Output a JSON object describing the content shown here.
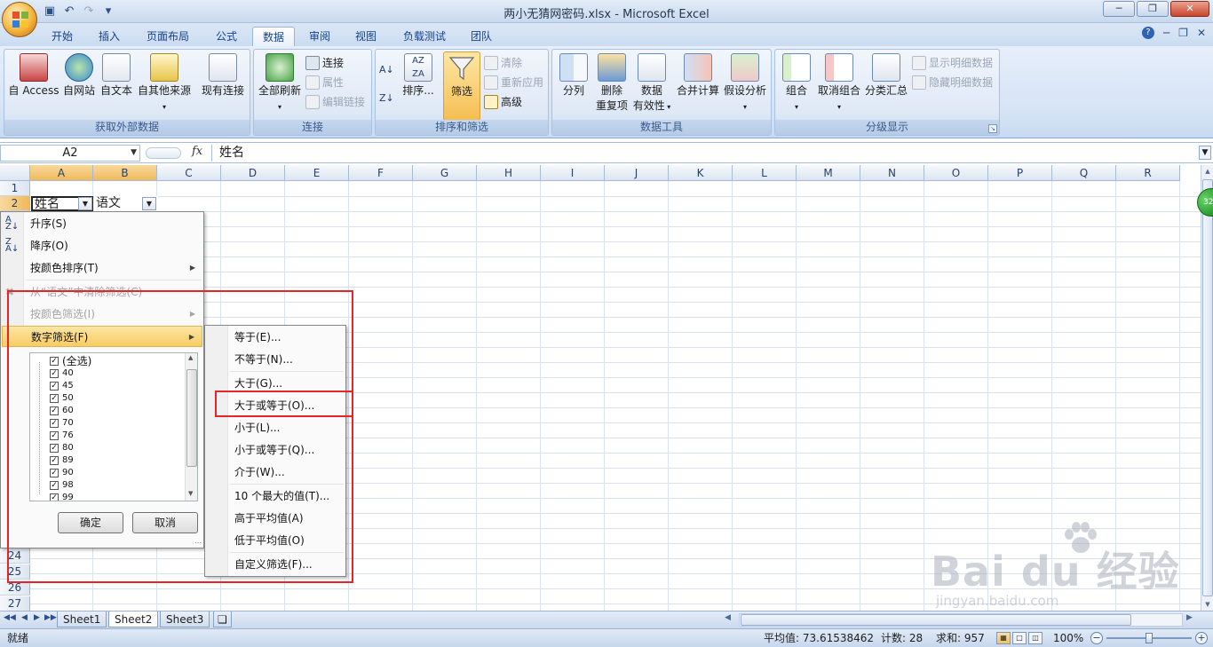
{
  "window": {
    "title": "两小无猜网密码.xlsx - Microsoft Excel"
  },
  "ribbon_tabs": [
    "开始",
    "插入",
    "页面布局",
    "公式",
    "数据",
    "审阅",
    "视图",
    "负载测试",
    "团队"
  ],
  "ribbon": {
    "external": {
      "label": "获取外部数据",
      "access": "自 Access",
      "web": "自网站",
      "text": "自文本",
      "other": "自其他来源",
      "existing": "现有连接"
    },
    "connections": {
      "label": "连接",
      "refresh_all": "全部刷新",
      "connections": "连接",
      "properties": "属性",
      "edit_links": "编辑链接"
    },
    "sort_filter": {
      "label": "排序和筛选",
      "sort": "排序...",
      "filter": "筛选",
      "clear": "清除",
      "reapply": "重新应用",
      "advanced": "高级"
    },
    "data_tools": {
      "label": "数据工具",
      "text_to_columns": "分列",
      "remove_dup_1": "删除",
      "remove_dup_2": "重复项",
      "validation_1": "数据",
      "validation_2": "有效性",
      "consolidate": "合并计算",
      "what_if": "假设分析"
    },
    "outline": {
      "label": "分级显示",
      "group": "组合",
      "ungroup": "取消组合",
      "subtotal": "分类汇总",
      "show_detail": "显示明细数据",
      "hide_detail": "隐藏明细数据"
    }
  },
  "formula_bar": {
    "name_box": "A2",
    "fx": "fx",
    "content": "姓名"
  },
  "columns": [
    "A",
    "B",
    "C",
    "D",
    "E",
    "F",
    "G",
    "H",
    "I",
    "J",
    "K",
    "L",
    "M",
    "N",
    "O",
    "P",
    "Q",
    "R"
  ],
  "rows_top": [
    "1",
    "2"
  ],
  "rows_bottom": [
    "24",
    "25",
    "26",
    "27"
  ],
  "cells": {
    "a2": "姓名",
    "b2": "语文"
  },
  "filter_menu": {
    "sort_asc": "升序(S)",
    "sort_desc": "降序(O)",
    "sort_by_color": "按颜色排序(T)",
    "clear_filter": "从“语文”中清除筛选(C)",
    "filter_by_color": "按颜色筛选(I)",
    "number_filter": "数字筛选(F)",
    "values": [
      "(全选)",
      "40",
      "45",
      "50",
      "60",
      "70",
      "76",
      "80",
      "89",
      "90",
      "98",
      "99"
    ],
    "ok": "确定",
    "cancel": "取消"
  },
  "number_filter_submenu": {
    "items": [
      "等于(E)...",
      "不等于(N)...",
      "大于(G)...",
      "大于或等于(O)...",
      "小于(L)...",
      "小于或等于(Q)...",
      "介于(W)...",
      "10 个最大的值(T)...",
      "高于平均值(A)",
      "低于平均值(O)",
      "自定义筛选(F)..."
    ]
  },
  "sheets": [
    "Sheet1",
    "Sheet2",
    "Sheet3"
  ],
  "status": {
    "ready": "就绪",
    "average": "平均值: 73.61538462",
    "count": "计数: 28",
    "sum": "求和: 957",
    "zoom": "100%"
  },
  "side_badge": "32",
  "watermark": {
    "main": "Bai du 经验",
    "sub": "jingyan.baidu.com"
  },
  "colors": {
    "highlight_box": "#e4252a",
    "menu_hover": "#f8cc63",
    "ribbon_text": "#15428b"
  }
}
